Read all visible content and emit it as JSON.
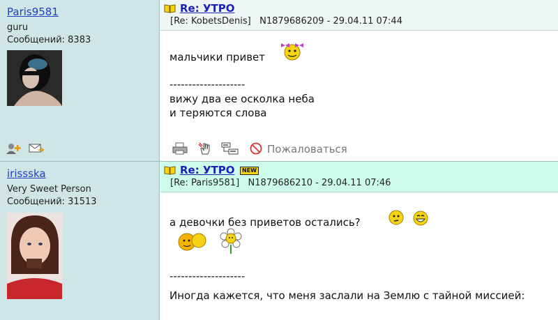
{
  "posts": [
    {
      "author": "Paris9581",
      "status": "guru",
      "count_label": "Сообщений: 8383",
      "title": "Re: УТРО",
      "reply_to": "[Re: KobetsDenis]",
      "meta": "N1879686209 - 29.04.11 07:44",
      "line1": "мальчики привет",
      "separator": "--------------------",
      "sig1": "вижу два ее осколка неба",
      "sig2": "и теряются слова",
      "report_label": "Пожаловаться",
      "is_new": false
    },
    {
      "author": "irissska",
      "status": "Very Sweet Person",
      "count_label": "Сообщений: 31513",
      "title": "Re: УТРО",
      "reply_to": "[Re: Paris9581]",
      "meta": "N1879686210 - 29.04.11 07:46",
      "line1": "а девочки без приветов остались?",
      "separator": "--------------------",
      "sig1": "Иногда кажется, что меня заслали на Землю с тайной миссией:",
      "new_badge": "NEW",
      "is_new": true
    }
  ],
  "colors": {
    "sidebar_bg": "#cfe5e6",
    "link": "#1a1fb5",
    "new_header": "#cdfbe9"
  }
}
